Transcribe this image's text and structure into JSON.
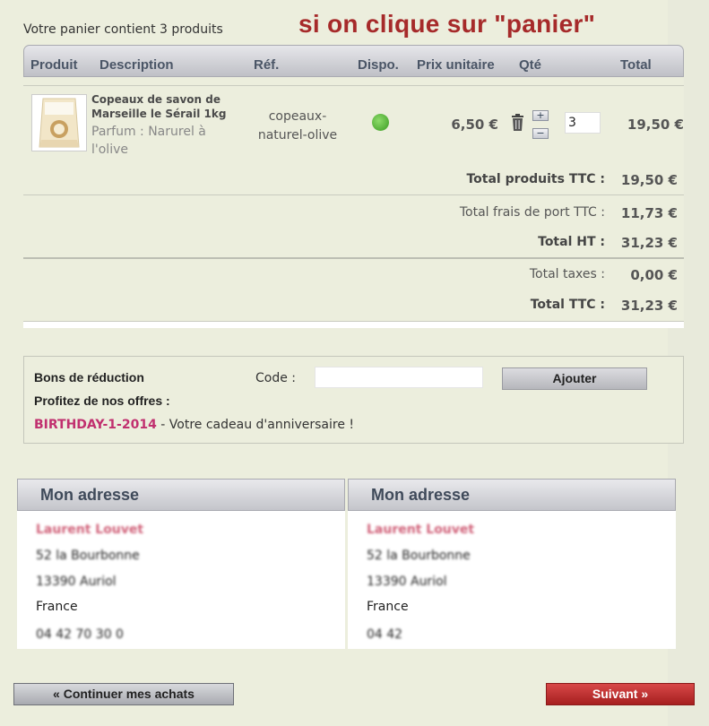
{
  "cart": {
    "summary": "Votre panier contient 3 produits",
    "annotation": "si on clique sur \"panier\"",
    "columns": {
      "product": "Produit",
      "description": "Description",
      "ref": "Réf.",
      "dispo": "Dispo.",
      "unit_price": "Prix unitaire",
      "qty": "Qté",
      "total": "Total"
    },
    "item": {
      "name": "Copeaux de savon de Marseille le Sérail 1kg",
      "attribute": "Parfum : Narurel à l'olive",
      "ref": "copeaux-naturel-olive",
      "availability_color": "#4caf2e",
      "unit_price": "6,50 €",
      "qty": "3",
      "qty_plus": "+",
      "qty_minus": "−",
      "total": "19,50 €"
    },
    "totals": {
      "products_label": "Total produits TTC :",
      "products_value": "19,50 €",
      "shipping_label": "Total frais de port TTC :",
      "shipping_value": "11,73 €",
      "ht_label": "Total HT :",
      "ht_value": "31,23 €",
      "taxes_label": "Total taxes :",
      "taxes_value": "0,00 €",
      "ttc_label": "Total TTC :",
      "ttc_value": "31,23 €"
    }
  },
  "voucher": {
    "title": "Bons de réduction",
    "code_label": "Code :",
    "code_value": "",
    "add_button": "Ajouter",
    "offers_title": "Profitez de nos offres :",
    "offer_code": "BIRTHDAY-1-2014",
    "offer_desc": " - Votre cadeau d'anniversaire !"
  },
  "addresses": {
    "delivery": {
      "title": "Mon adresse",
      "name": "Laurent Louvet",
      "street": "52 la Bourbonne",
      "city": "13390 Auriol",
      "country": "France",
      "phone": "04 42 70 30 0"
    },
    "invoice": {
      "title": "Mon adresse",
      "name": "Laurent Louvet",
      "street": "52 la Bourbonne",
      "city": "13390 Auriol",
      "country": "France",
      "phone": "04 42"
    }
  },
  "nav": {
    "continue": "« Continuer mes achats",
    "next": "Suivant »"
  },
  "colors": {
    "background": "#eceedd",
    "annotation": "#a62a2a",
    "offer_code": "#c1306f",
    "next_button": "#b52828"
  }
}
